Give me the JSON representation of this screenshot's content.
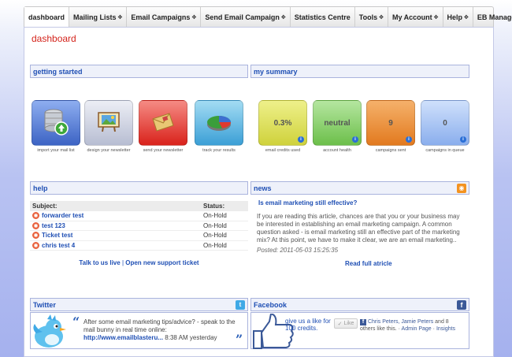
{
  "nav": {
    "items": [
      {
        "label": "dashboard",
        "dropdown": false
      },
      {
        "label": "Mailing Lists",
        "dropdown": true
      },
      {
        "label": "Email Campaigns",
        "dropdown": true
      },
      {
        "label": "Send Email Campaign",
        "dropdown": true
      },
      {
        "label": "Statistics Centre",
        "dropdown": false
      },
      {
        "label": "Tools",
        "dropdown": true
      },
      {
        "label": "My Account",
        "dropdown": true
      },
      {
        "label": "Help",
        "dropdown": true
      },
      {
        "label": "EB Manager",
        "dropdown": false
      }
    ]
  },
  "page": {
    "title": "dashboard"
  },
  "getting_started": {
    "heading": "getting started",
    "tiles": [
      {
        "caption": "import your mail list",
        "icon": "database-add-icon",
        "color": "#4a76cf"
      },
      {
        "caption": "design your newsletter",
        "icon": "easel-icon",
        "color": "#cfd3e4"
      },
      {
        "caption": "send your newsletter",
        "icon": "envelope-icon",
        "color": "#e6362f"
      },
      {
        "caption": "track your results",
        "icon": "pie-chart-icon",
        "color": "#58b8e0"
      }
    ]
  },
  "summary": {
    "heading": "my summary",
    "tiles": [
      {
        "value": "0.3%",
        "caption": "email credits used",
        "color": "#dde04f"
      },
      {
        "value": "neutral",
        "caption": "account health",
        "color": "#8bd06a"
      },
      {
        "value": "9",
        "caption": "campaigns sent",
        "color": "#ee8a2e"
      },
      {
        "value": "0",
        "caption": "campaigns in queue",
        "color": "#9dbcf1"
      }
    ]
  },
  "help": {
    "heading": "help",
    "col_subject": "Subject:",
    "col_status": "Status:",
    "rows": [
      {
        "subject": "forwarder test",
        "status": "On-Hold"
      },
      {
        "subject": "test 123",
        "status": "On-Hold"
      },
      {
        "subject": "Ticket test",
        "status": "On-Hold"
      },
      {
        "subject": "chris test 4",
        "status": "On-Hold"
      }
    ],
    "talk_link": "Talk to us live",
    "separator": "|",
    "ticket_link": "Open new support ticket"
  },
  "news": {
    "heading": "news",
    "title": "Is email marketing still effective?",
    "body": "If you are reading this article, chances are that you or your business may be interested in establishing an email marketing campaign. A common question asked - is email marketing still an effective part of the marketing mix? At this point, we have to make it clear, we are an email marketing..",
    "posted": "Posted: 2011-05-03 15:25:35",
    "read_more": "Read full atricle"
  },
  "twitter": {
    "heading": "Twitter",
    "tweet": "After some email marketing tips/advice? - speak to the mail bunny in real time online:",
    "link": "http://www.emailblasteru...",
    "time": "8:38 AM yesterday"
  },
  "facebook": {
    "heading": "Facebook",
    "like_prompt": "give us a like for 100 credits.",
    "like_button": "Like",
    "names": "Chris Peters, Jamie Peters",
    "others": "and 8 others like this.",
    "admin_page": "Admin Page",
    "insights": "Insights",
    "dot": "·"
  }
}
